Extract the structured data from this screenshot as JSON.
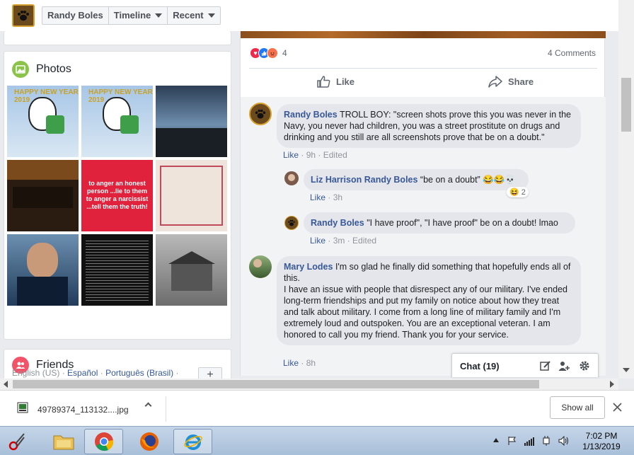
{
  "header": {
    "profile_name": "Randy Boles",
    "timeline_label": "Timeline",
    "recent_label": "Recent"
  },
  "left": {
    "photos_title": "Photos",
    "photo_captions": {
      "p5_text": "to anger an honest person ...lie to them to anger a narcissist ...tell them the truth!",
      "p1_text": "HAPPY NEW YEAR 2019",
      "p2_text": "HAPPY NEW YEAR 2019"
    },
    "friends_title": "Friends",
    "footer": {
      "lang_current": "English (US)",
      "lang_es": "Español",
      "lang_pt": "Português (Brasil)",
      "sep": " · ",
      "plus": "+"
    }
  },
  "post": {
    "reaction_count": "4",
    "comments_count": "4 Comments",
    "like_label": "Like",
    "share_label": "Share",
    "comments": [
      {
        "name": "Randy Boles",
        "text": " TROLL BOY: \"screen shots prove this you was never in the Navy, you never had children, you was a street prostitute on drugs and drinking and you still are all screenshots prove that be on a doubt.\"",
        "like": "Like",
        "time": "9h",
        "edited": "Edited"
      },
      {
        "name": "Liz Harrison",
        "mention": "Randy Boles",
        "text": " “be on a doubt” 😂😂💀",
        "like": "Like",
        "time": "3h",
        "reaction_count": "2"
      },
      {
        "name": "Randy Boles",
        "text": " \"I have proof\", \"I have proof\" be on a doubt! lmao",
        "like": "Like",
        "time": "3m",
        "edited": "Edited"
      },
      {
        "name": "Mary Lodes",
        "text": " I'm so glad he finally did something that hopefully ends all of this.",
        "text2": "I have an issue with people that disrespect any of our military. I've ended long-term friendships and put my family on notice about how they treat and talk about military. I come from a long line of military family and I'm extremely loud and outspoken. You are an exceptional veteran. I am honored to call you my friend. Thank you for your service.",
        "like": "Like",
        "time": "8h"
      }
    ]
  },
  "chat": {
    "label": "Chat (19)"
  },
  "download": {
    "filename": "49789374_113132....jpg",
    "show_all": "Show all"
  },
  "taskbar": {
    "time": "7:02 PM",
    "date": "1/13/2019"
  },
  "colors": {
    "link": "#385898",
    "fb_gray": "#e9ebee"
  }
}
